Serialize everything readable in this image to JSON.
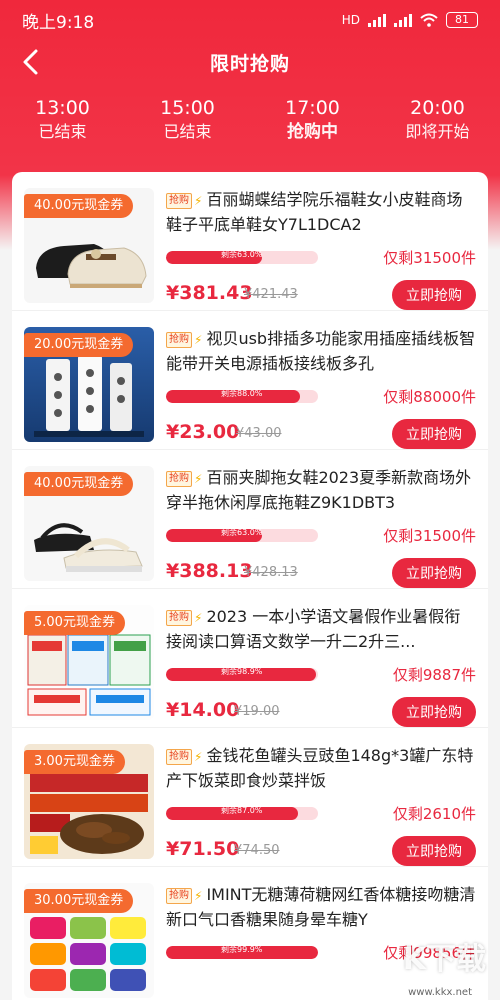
{
  "status_bar": {
    "time": "晚上9:18",
    "battery": "81",
    "network": "HD"
  },
  "nav": {
    "title": "限时抢购"
  },
  "sessions": [
    {
      "time": "13:00",
      "status": "已结束",
      "active": false
    },
    {
      "time": "15:00",
      "status": "已结束",
      "active": false
    },
    {
      "time": "17:00",
      "status": "抢购中",
      "active": true
    },
    {
      "time": "20:00",
      "status": "即将开始",
      "active": false
    }
  ],
  "items": [
    {
      "coupon": "40.00元现金券",
      "tag": "抢购",
      "title": "百丽蝴蝶结学院乐福鞋女小皮鞋商场鞋子平底单鞋女Y7L1DCA2",
      "remaining_pct": "剩余63.0%",
      "fill": 0.63,
      "remain_text": "仅剩31500件",
      "price": "¥381.43",
      "old_price": "¥421.43",
      "button": "立即抢购"
    },
    {
      "coupon": "20.00元现金券",
      "tag": "抢购",
      "title": "视贝usb排插多功能家用插座插线板智能带开关电源插板接线板多孔",
      "remaining_pct": "剩余88.0%",
      "fill": 0.88,
      "remain_text": "仅剩88000件",
      "price": "¥23.00",
      "old_price": "¥43.00",
      "button": "立即抢购"
    },
    {
      "coupon": "40.00元现金券",
      "tag": "抢购",
      "title": "百丽夹脚拖女鞋2023夏季新款商场外穿半拖休闲厚底拖鞋Z9K1DBT3",
      "remaining_pct": "剩余63.0%",
      "fill": 0.63,
      "remain_text": "仅剩31500件",
      "price": "¥388.13",
      "old_price": "¥428.13",
      "button": "立即抢购"
    },
    {
      "coupon": "5.00元现金券",
      "tag": "抢购",
      "title": "2023 一本小学语文暑假作业暑假衔接阅读口算语文数学一升二2升三...",
      "remaining_pct": "剩余98.9%",
      "fill": 0.989,
      "remain_text": "仅剩9887件",
      "price": "¥14.00",
      "old_price": "¥19.00",
      "button": "立即抢购"
    },
    {
      "coupon": "3.00元现金券",
      "tag": "抢购",
      "title": "金钱花鱼罐头豆豉鱼148g*3罐广东特产下饭菜即食炒菜拌饭",
      "remaining_pct": "剩余87.0%",
      "fill": 0.87,
      "remain_text": "仅剩2610件",
      "price": "¥71.50",
      "old_price": "¥74.50",
      "button": "立即抢购"
    },
    {
      "coupon": "30.00元现金券",
      "tag": "抢购",
      "title": "IMINT无糖薄荷糖网红香体糖接吻糖清新口气口香糖果随身晕车糖Y",
      "remaining_pct": "剩余99.9%",
      "fill": 0.999,
      "remain_text": "仅剩99856件",
      "price": "",
      "old_price": "",
      "button": ""
    }
  ],
  "watermark": {
    "text": "K下载",
    "url": "www.kkx.net"
  },
  "colors": {
    "brand_red": "#e8283f",
    "coupon_orange": "#f46a2f",
    "header_red": "#f0283c"
  }
}
